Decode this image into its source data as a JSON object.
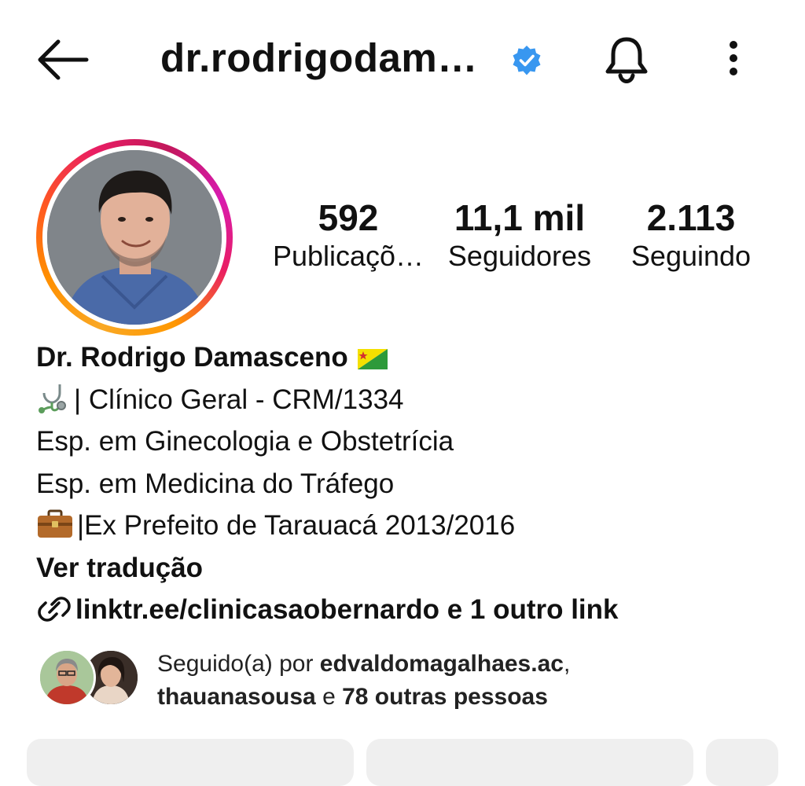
{
  "header": {
    "username": "dr.rodrigodam…",
    "verified_icon": "verified-badge-icon",
    "back_icon": "arrow-left-icon",
    "bell_icon": "bell-icon",
    "menu_icon": "more-vertical-icon"
  },
  "stats": [
    {
      "value": "592",
      "label": "Publicaçõ…"
    },
    {
      "value": "11,1 mil",
      "label": "Seguidores"
    },
    {
      "value": "2.113",
      "label": "Seguindo"
    }
  ],
  "bio": {
    "name": "Dr. Rodrigo Damasceno",
    "lines": [
      "| Clínico Geral - CRM/1334",
      "Esp. em Ginecologia e Obstetrícia",
      "Esp. em Medicina do Tráfego",
      "|Ex Prefeito de Tarauacá 2013/2016"
    ],
    "translate_label": "Ver tradução",
    "link_text": "linktr.ee/clinicasaobernardo e 1 outro link"
  },
  "followed_by": {
    "prefix": "Seguido(a) por ",
    "user1": "edvaldomagalhaes.ac",
    "sep": ",",
    "user2": "thauanasousa",
    "connector": " e ",
    "others": "78 outras pessoas"
  },
  "colors": {
    "verified": "#3897f0",
    "button_bg": "#efefef"
  }
}
